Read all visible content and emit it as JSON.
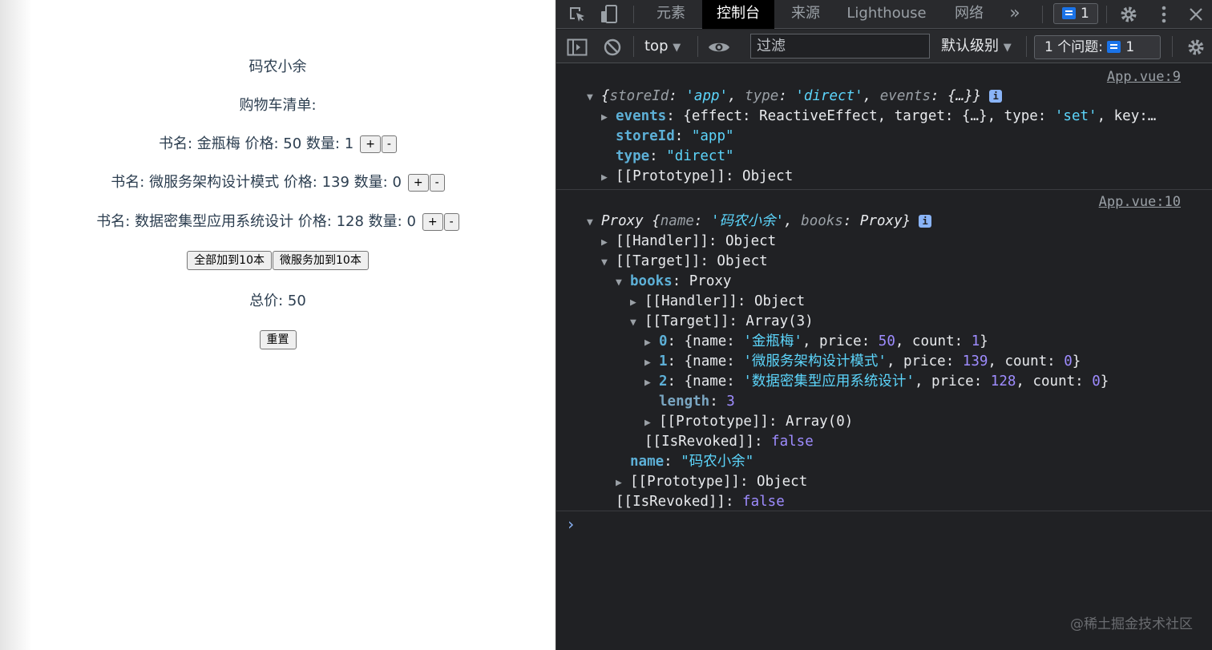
{
  "page": {
    "title": "码农小余",
    "list_heading": "购物车清单:",
    "books": [
      {
        "line": "书名: 金瓶梅 价格: 50 数量: ",
        "count": "1"
      },
      {
        "line": "书名: 微服务架构设计模式 价格: 139 数量: ",
        "count": "0"
      },
      {
        "line": "书名: 数据密集型应用系统设计 价格: 128 数量: ",
        "count": "0"
      }
    ],
    "inc_label": "+",
    "dec_label": "-",
    "all_to_10_label": "全部加到10本",
    "micro_to_10_label": "微服务加到10本",
    "total_text": "总价: 50",
    "reset_label": "重置"
  },
  "devtools": {
    "tabs": [
      "元素",
      "控制台",
      "来源",
      "Lighthouse",
      "网络"
    ],
    "active_tab": "控制台",
    "more_tabs": "»",
    "issues_badge_count": "1",
    "context": "top",
    "filter_placeholder": "过滤",
    "level": "默认级别",
    "issues_label": "1 个问题:",
    "issues_count": "1",
    "icons": [
      "inspect-icon",
      "device-toolbar-icon",
      "gear-icon",
      "kebab-menu-icon",
      "sidebar-icon",
      "clear-console-icon",
      "eye-icon",
      "chevron-down-icon"
    ],
    "colors": {
      "background": "#202124",
      "toolbar": "#292a2d",
      "key": "#5db0d7",
      "string": "#5cd5fb",
      "number": "#9e8cff",
      "link_blue": "#1a73e8"
    },
    "log1": {
      "source": "App.vue:9",
      "summary_prefix": "{",
      "summary_k1": "storeId",
      "summary_v1": "'app'",
      "summary_k2": "type",
      "summary_v2": "'direct'",
      "summary_k3": "events",
      "summary_v3": "{…}}",
      "events_key": "events",
      "events_val_a": "{effect: ReactiveEffect, target: {…}, type: ",
      "events_val_s": "'set'",
      "events_val_b": ", key:…",
      "storeId_key": "storeId",
      "storeId_val": "\"app\"",
      "type_key": "type",
      "type_val": "\"direct\"",
      "proto": "[[Prototype]]: Object"
    },
    "log2": {
      "source": "App.vue:10",
      "summary_a": "Proxy {",
      "summary_k1": "name",
      "summary_v1": "'码农小余'",
      "summary_k2": "books",
      "summary_v2": "Proxy}",
      "handler": "[[Handler]]: Object",
      "target": "[[Target]]: Object",
      "books_key": "books",
      "books_val": "Proxy",
      "books_handler": "[[Handler]]: Object",
      "books_target": "[[Target]]: Array(3)",
      "items": [
        {
          "idx": "0",
          "name": "'金瓶梅'",
          "price": "50",
          "count": "1"
        },
        {
          "idx": "1",
          "name": "'微服务架构设计模式'",
          "price": "139",
          "count": "0"
        },
        {
          "idx": "2",
          "name": "'数据密集型应用系统设计'",
          "price": "128",
          "count": "0"
        }
      ],
      "length_key": "length",
      "length_val": "3",
      "arr_proto": "[[Prototype]]: Array(0)",
      "inner_revoked_key": "[[IsRevoked]]",
      "inner_revoked_val": "false",
      "name_key": "name",
      "name_val": "\"码农小余\"",
      "obj_proto": "[[Prototype]]: Object",
      "outer_revoked_key": "[[IsRevoked]]",
      "outer_revoked_val": "false"
    },
    "prompt": "›",
    "watermark": "@稀土掘金技术社区"
  }
}
